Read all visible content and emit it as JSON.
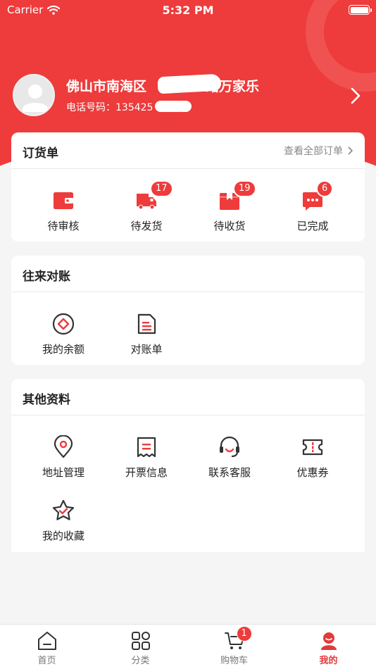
{
  "status_bar": {
    "carrier": "Carrier",
    "time": "5:32 PM"
  },
  "profile": {
    "name_prefix": "佛山市南海区",
    "name_suffix": "路万家乐",
    "phone_label": "电话号码：",
    "phone_visible": "135425"
  },
  "orders": {
    "title": "订货单",
    "view_all": "查看全部订单",
    "items": [
      {
        "label": "待审核",
        "icon": "wallet-icon",
        "badge": ""
      },
      {
        "label": "待发货",
        "icon": "truck-icon",
        "badge": "17"
      },
      {
        "label": "待收货",
        "icon": "package-icon",
        "badge": "19"
      },
      {
        "label": "已完成",
        "icon": "chat-dots-icon",
        "badge": "6"
      }
    ]
  },
  "accounts": {
    "title": "往来对账",
    "items": [
      {
        "label": "我的余额",
        "icon": "balance-icon"
      },
      {
        "label": "对账单",
        "icon": "statement-icon"
      }
    ]
  },
  "other": {
    "title": "其他资料",
    "items": [
      {
        "label": "地址管理",
        "icon": "location-icon"
      },
      {
        "label": "开票信息",
        "icon": "invoice-icon"
      },
      {
        "label": "联系客服",
        "icon": "headset-icon"
      },
      {
        "label": "优惠券",
        "icon": "coupon-icon"
      },
      {
        "label": "我的收藏",
        "icon": "star-icon"
      }
    ]
  },
  "tabbar": {
    "items": [
      {
        "label": "首页",
        "icon": "home-icon"
      },
      {
        "label": "分类",
        "icon": "category-icon"
      },
      {
        "label": "购物车",
        "icon": "cart-icon",
        "badge": "1"
      },
      {
        "label": "我的",
        "icon": "user-icon"
      }
    ],
    "active_index": 3
  },
  "colors": {
    "brand_red": "#ee3b3b",
    "background": "#f5f5f5",
    "active_tab": "#e23a3a"
  }
}
